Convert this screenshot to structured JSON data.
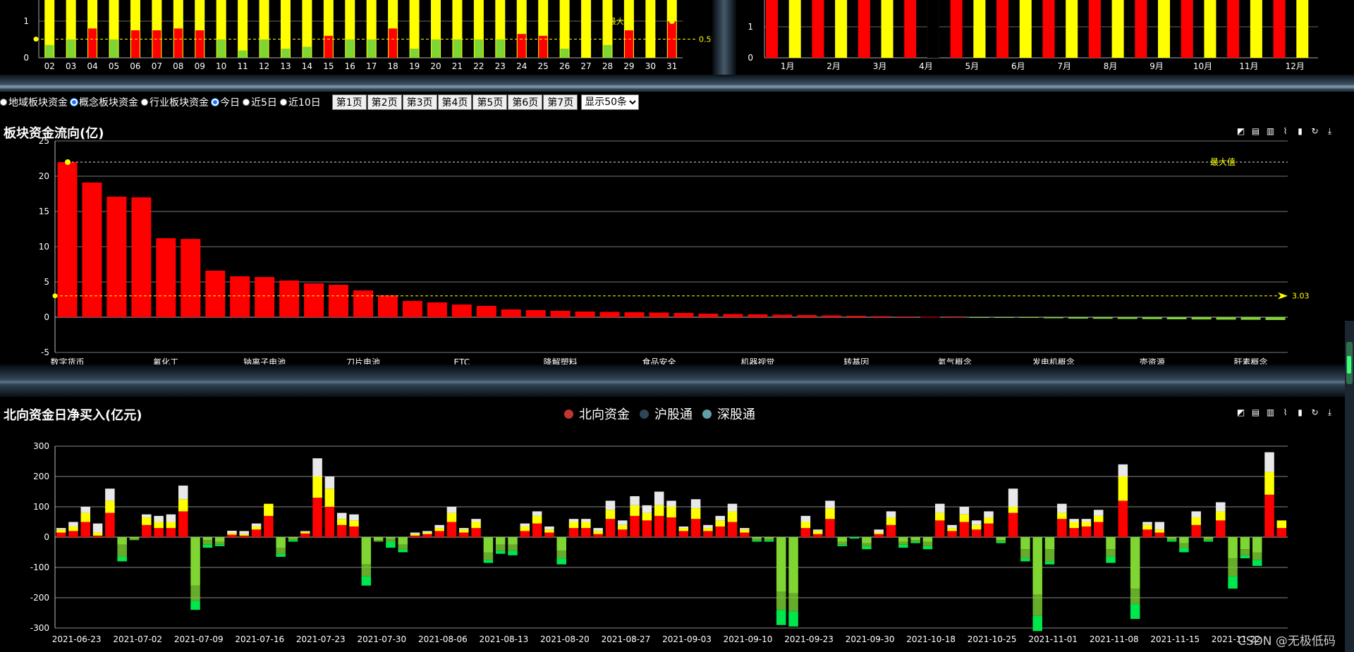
{
  "controls": {
    "radios": [
      {
        "label": "地域板块资金",
        "checked": false
      },
      {
        "label": "概念板块资金",
        "checked": true
      },
      {
        "label": "行业板块资金",
        "checked": false
      },
      {
        "label": "今日",
        "checked": true
      },
      {
        "label": "近5日",
        "checked": false
      },
      {
        "label": "近10日",
        "checked": false
      }
    ],
    "pages": [
      "第1页",
      "第2页",
      "第3页",
      "第4页",
      "第5页",
      "第6页",
      "第7页"
    ],
    "page_size": "显示50条"
  },
  "sector": {
    "title": "板块资金流向(亿)",
    "max_label": "最大值",
    "avg_label": "3.03"
  },
  "north": {
    "title": "北向资金日净买入(亿元)",
    "legend": [
      "北向资金",
      "沪股通",
      "深股通"
    ]
  },
  "watermark": "CSDN @无极低码",
  "colors": {
    "red": "#ff0000",
    "yellow": "#ffff00",
    "green": "#7fd633",
    "bright_green": "#00e64d",
    "white": "#e8e8e8",
    "legend_red": "#c23531",
    "legend_navy": "#2f4554",
    "legend_teal": "#61a0a8"
  },
  "chart_data": [
    {
      "type": "bar",
      "categories": [
        "02",
        "03",
        "04",
        "05",
        "06",
        "07",
        "08",
        "09",
        "10",
        "11",
        "12",
        "13",
        "14",
        "15",
        "16",
        "17",
        "18",
        "19",
        "20",
        "21",
        "22",
        "23",
        "24",
        "25",
        "26",
        "27",
        "28",
        "29",
        "30",
        "31"
      ],
      "values": [
        0.35,
        0.5,
        0.8,
        0.5,
        0.75,
        0.75,
        0.8,
        0.75,
        0.5,
        0.2,
        0.5,
        0.25,
        0.3,
        0.6,
        0.5,
        0.5,
        0.8,
        0.25,
        0.5,
        0.5,
        0.5,
        0.5,
        0.65,
        0.6,
        0.25,
        0,
        0.35,
        0.75,
        0,
        1
      ],
      "background_value": 1,
      "mark_line": 0.51,
      "mark_label": "0.51",
      "max_label": "最大",
      "yticks": [
        "0",
        "1"
      ],
      "ylim": [
        0,
        1.1
      ]
    },
    {
      "type": "bar",
      "categories": [
        "1月",
        "2月",
        "3月",
        "4月",
        "5月",
        "6月",
        "7月",
        "8月",
        "9月",
        "10月",
        "11月",
        "12月"
      ],
      "values": [
        1,
        1,
        1,
        1,
        1,
        1,
        1,
        1,
        1,
        1,
        1,
        1
      ],
      "background_values": [
        1,
        1,
        1,
        0,
        1,
        1,
        1,
        1,
        1,
        1,
        1,
        1
      ],
      "small_values": [
        0,
        0,
        0,
        0,
        0.95,
        0,
        0,
        0,
        0,
        0,
        0,
        0
      ],
      "yticks": [
        "0",
        "1"
      ],
      "ylim": [
        0,
        1.1
      ]
    },
    {
      "type": "bar",
      "title": "板块资金流向(亿)",
      "categories": [
        "数字货币",
        "",
        "",
        "",
        "氟化工",
        "",
        "",
        "",
        "钠离子电池",
        "",
        "",
        "",
        "刀片电池",
        "",
        "",
        "",
        "ETC",
        "",
        "",
        "",
        "降解塑料",
        "",
        "",
        "",
        "食品安全",
        "",
        "",
        "",
        "机器视觉",
        "",
        "",
        "",
        "转基因",
        "",
        "",
        "",
        "氦气概念",
        "",
        "",
        "",
        "发电机概念",
        "",
        "",
        "",
        "壳资源",
        "",
        "",
        "",
        "肝素概念",
        ""
      ],
      "values": [
        22,
        19.1,
        17.1,
        17,
        11.2,
        11.1,
        6.6,
        5.8,
        5.7,
        5.2,
        4.8,
        4.6,
        3.8,
        3.1,
        2.3,
        2.1,
        1.8,
        1.6,
        1.1,
        1.0,
        0.9,
        0.8,
        0.75,
        0.7,
        0.65,
        0.6,
        0.5,
        0.45,
        0.4,
        0.35,
        0.3,
        0.25,
        0.2,
        0.15,
        0.1,
        0.05,
        0,
        -0.05,
        -0.08,
        -0.1,
        -0.15,
        -0.2,
        -0.22,
        -0.25,
        -0.27,
        -0.3,
        -0.32,
        -0.35,
        -0.37,
        -0.4
      ],
      "ylim": [
        -5,
        25
      ],
      "yticks": [
        -5,
        0,
        5,
        10,
        15,
        20,
        25
      ],
      "max_value": 22,
      "average": 3.03
    },
    {
      "type": "bar",
      "title": "北向资金日净买入(亿元)",
      "x_ticks": [
        "2021-06-23",
        "2021-07-02",
        "2021-07-09",
        "2021-07-16",
        "2021-07-23",
        "2021-07-30",
        "2021-08-06",
        "2021-08-13",
        "2021-08-20",
        "2021-08-27",
        "2021-09-03",
        "2021-09-10",
        "2021-09-23",
        "2021-09-30",
        "2021-10-18",
        "2021-10-25",
        "2021-11-01",
        "2021-11-08",
        "2021-11-15",
        "2021-11-22"
      ],
      "series": [
        {
          "name": "北向资金",
          "values": [
            15,
            20,
            50,
            5,
            80,
            -25,
            -5,
            40,
            30,
            30,
            85,
            -160,
            -10,
            -15,
            8,
            5,
            25,
            70,
            -35,
            -5,
            12,
            130,
            100,
            40,
            35,
            -90,
            -10,
            -5,
            -25,
            5,
            10,
            20,
            50,
            15,
            30,
            -50,
            -25,
            -25,
            20,
            45,
            15,
            -45,
            30,
            30,
            10,
            60,
            25,
            70,
            55,
            70,
            65,
            20,
            60,
            20,
            35,
            50,
            15,
            -5,
            -5,
            -180,
            -185,
            30,
            10,
            60,
            -15,
            0,
            -20,
            10,
            40,
            -15,
            -10,
            -15,
            55,
            20,
            50,
            25,
            45,
            -10,
            80,
            -40,
            -190,
            -40,
            60,
            30,
            35,
            50,
            -40,
            120,
            -170,
            25,
            15,
            -5,
            -20,
            40,
            -5,
            55,
            -70,
            -40,
            -50,
            140,
            30
          ]
        },
        {
          "name": "沪股通",
          "values": [
            10,
            15,
            30,
            10,
            40,
            -40,
            -5,
            25,
            20,
            20,
            40,
            -50,
            -15,
            -10,
            5,
            5,
            10,
            40,
            -20,
            -5,
            5,
            70,
            60,
            20,
            20,
            -40,
            -5,
            -10,
            -15,
            5,
            5,
            10,
            30,
            10,
            20,
            -25,
            -20,
            -20,
            15,
            25,
            10,
            -25,
            20,
            20,
            10,
            30,
            15,
            35,
            25,
            35,
            35,
            10,
            35,
            10,
            20,
            35,
            10,
            -5,
            -5,
            -60,
            -60,
            20,
            10,
            35,
            -10,
            0,
            -10,
            5,
            25,
            -10,
            -5,
            -15,
            25,
            10,
            25,
            15,
            20,
            -5,
            20,
            -30,
            -70,
            -40,
            20,
            20,
            15,
            20,
            -25,
            80,
            -50,
            15,
            10,
            -5,
            -15,
            25,
            -5,
            30,
            -60,
            -20,
            -25,
            75,
            25
          ]
        },
        {
          "name": "深股通",
          "values": [
            5,
            15,
            20,
            30,
            40,
            -15,
            0,
            10,
            20,
            25,
            45,
            -30,
            -10,
            -5,
            8,
            10,
            10,
            0,
            -10,
            -5,
            3,
            60,
            40,
            20,
            20,
            -30,
            0,
            -20,
            -10,
            5,
            5,
            10,
            20,
            5,
            10,
            -10,
            -10,
            -15,
            10,
            15,
            10,
            -20,
            10,
            10,
            10,
            30,
            15,
            30,
            25,
            45,
            20,
            5,
            30,
            10,
            15,
            25,
            5,
            -5,
            -5,
            -50,
            -50,
            20,
            5,
            25,
            -5,
            -5,
            -10,
            10,
            20,
            -10,
            -5,
            -10,
            30,
            10,
            25,
            15,
            20,
            -5,
            60,
            -10,
            -50,
            -10,
            30,
            10,
            10,
            20,
            -20,
            40,
            -50,
            10,
            25,
            -5,
            -15,
            20,
            -5,
            30,
            -40,
            -10,
            -20,
            65,
            0
          ]
        }
      ],
      "ylim": [
        -300,
        300
      ],
      "yticks": [
        -300,
        -200,
        -100,
        0,
        100,
        200,
        300
      ]
    }
  ]
}
